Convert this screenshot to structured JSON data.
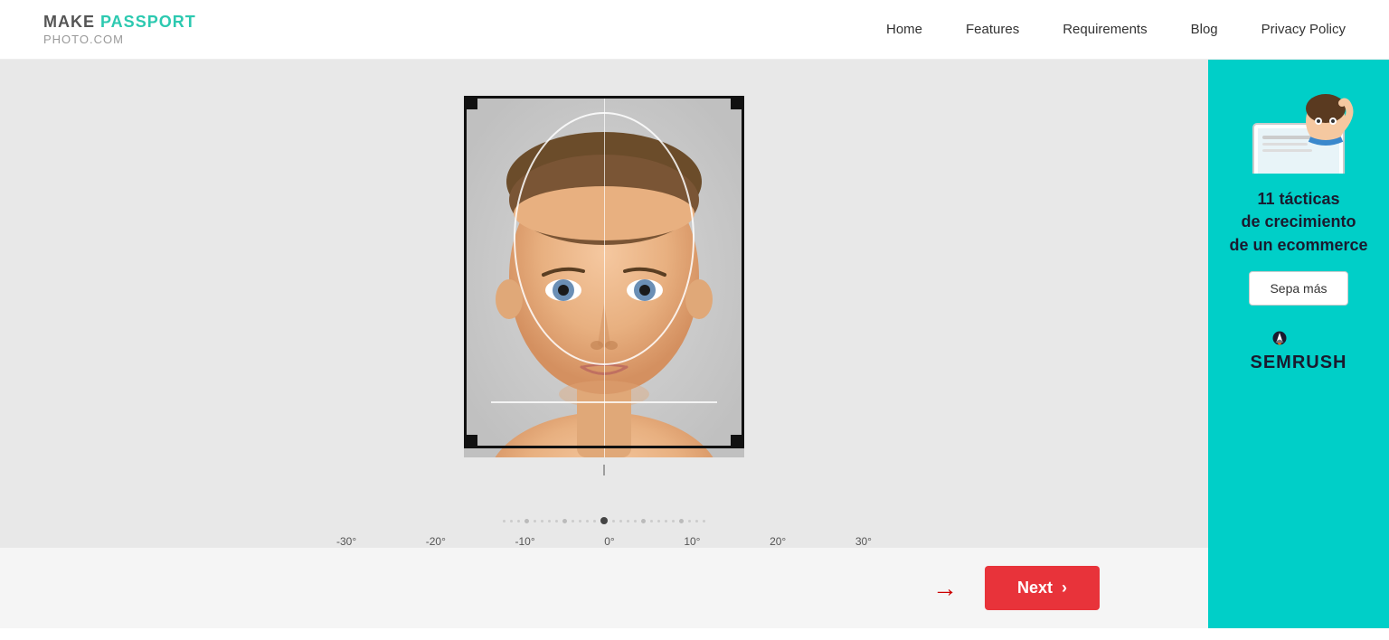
{
  "header": {
    "logo_make": "MAKE",
    "logo_passport": "PASSPORT",
    "logo_bottom": "PHOTO.COM",
    "nav": {
      "items": [
        {
          "label": "Home",
          "id": "nav-home"
        },
        {
          "label": "Features",
          "id": "nav-features"
        },
        {
          "label": "Requirements",
          "id": "nav-requirements"
        },
        {
          "label": "Blog",
          "id": "nav-blog"
        },
        {
          "label": "Privacy Policy",
          "id": "nav-privacy"
        }
      ]
    }
  },
  "editor": {
    "rotation_labels": [
      "-30°",
      "-20°",
      "-10°",
      "0°",
      "10°",
      "20°",
      "30°"
    ]
  },
  "next_button": {
    "label": "Next",
    "chevron": "›"
  },
  "ad": {
    "title": "11 tácticas\nde crecimiento\nde un ecommerce",
    "cta_label": "Sepa más",
    "brand": "SEMRUSH"
  }
}
